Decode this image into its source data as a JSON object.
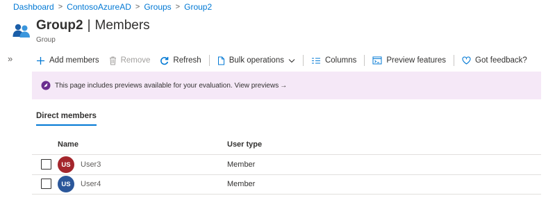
{
  "breadcrumb": [
    "Dashboard",
    "ContosoAzureAD",
    "Groups",
    "Group2"
  ],
  "header": {
    "title": "Group2",
    "subtitle_section": "Members",
    "caption": "Group"
  },
  "toolbar": {
    "add_members": "Add members",
    "remove": "Remove",
    "refresh": "Refresh",
    "bulk_operations": "Bulk operations",
    "columns": "Columns",
    "preview_features": "Preview features",
    "feedback": "Got feedback?"
  },
  "banner": {
    "text": "This page includes previews available for your evaluation. View previews",
    "arrow": "→",
    "color": "#f5e8f7"
  },
  "tabs": [
    {
      "label": "Direct members",
      "active": true
    }
  ],
  "table": {
    "columns": [
      "Name",
      "User type"
    ],
    "rows": [
      {
        "initials": "US",
        "name": "User3",
        "user_type": "Member",
        "avatar_color": "#a4262c"
      },
      {
        "initials": "US",
        "name": "User4",
        "user_type": "Member",
        "avatar_color": "#2b579a"
      }
    ]
  },
  "colors": {
    "accent": "#0078d4"
  }
}
